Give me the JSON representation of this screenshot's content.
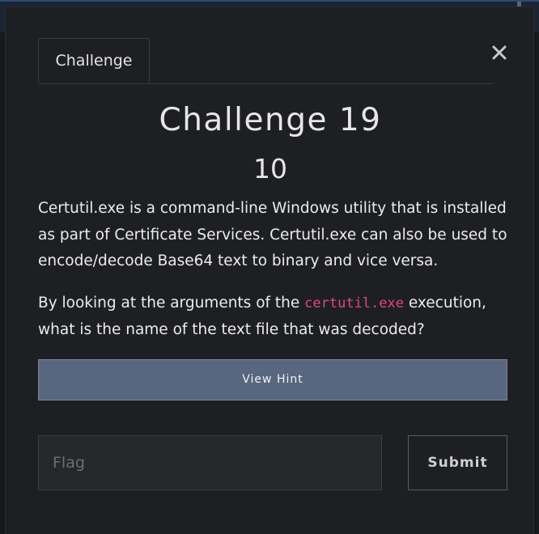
{
  "modal": {
    "tab_label": "Challenge",
    "close_icon": "close-icon",
    "title": "Challenge 19",
    "points": "10",
    "description": "Certutil.exe is a command-line Windows utility that is installed as part of Certificate Services. Certutil.exe can also be used to encode/decode Base64 text to binary and vice versa.",
    "question_before": "By looking at the arguments of the ",
    "question_code": "certutil.exe",
    "question_after": " execution, what is the name of the text file that was decoded?",
    "hint_label": "View Hint",
    "flag_placeholder": "Flag",
    "flag_value": "",
    "submit_label": "Submit"
  },
  "colors": {
    "modal_bg": "#1e1f22",
    "hint_bg": "#58667f",
    "code_accent": "#e0468a",
    "text": "#ececec"
  }
}
